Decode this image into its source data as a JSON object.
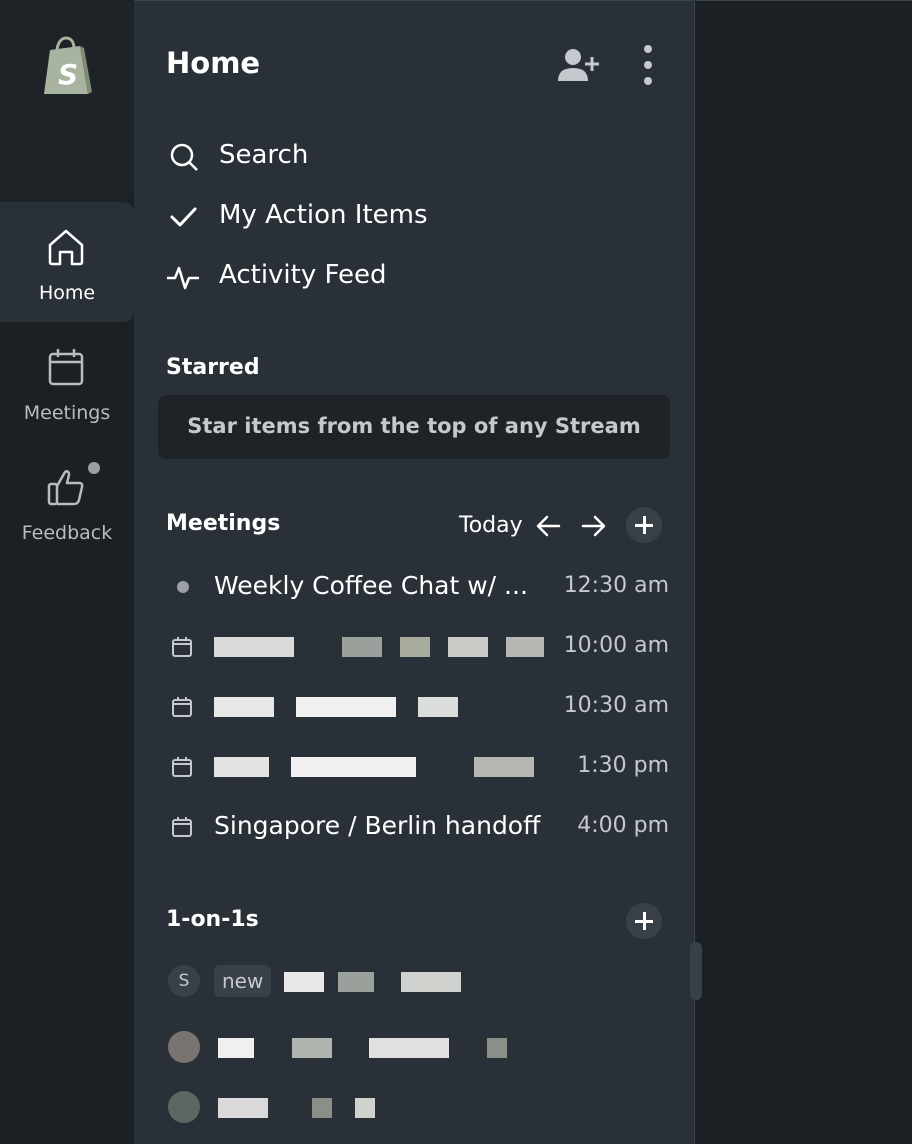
{
  "rail": {
    "items": [
      {
        "label": "Home",
        "icon": "home-icon",
        "active": true
      },
      {
        "label": "Meetings",
        "icon": "calendar-icon",
        "active": false
      },
      {
        "label": "Feedback",
        "icon": "thumbs-up-icon",
        "active": false
      }
    ]
  },
  "header": {
    "title": "Home",
    "add_user_icon": "add-user-icon",
    "more_icon": "more-vertical-icon"
  },
  "nav": [
    {
      "label": "Search",
      "icon": "search-icon"
    },
    {
      "label": "My Action Items",
      "icon": "check-icon"
    },
    {
      "label": "Activity Feed",
      "icon": "activity-icon"
    }
  ],
  "starred": {
    "title": "Starred",
    "empty_text": "Star items from the top of any Stream"
  },
  "meetings": {
    "title": "Meetings",
    "today_label": "Today",
    "items": [
      {
        "title": "Weekly Coffee Chat w/ ...",
        "time": "12:30 am",
        "icon": "dot"
      },
      {
        "title": "",
        "time": "10:00 am",
        "icon": "calendar-icon"
      },
      {
        "title": "",
        "time": "10:30 am",
        "icon": "calendar-icon"
      },
      {
        "title": "",
        "time": "1:30 pm",
        "icon": "calendar-icon"
      },
      {
        "title": "Singapore / Berlin handoff",
        "time": "4:00 pm",
        "icon": "calendar-icon"
      }
    ]
  },
  "one_on_ones": {
    "title": "1-on-1s",
    "items": [
      {
        "avatar_letter": "S",
        "tag": "new"
      },
      {
        "avatar_letter": ""
      },
      {
        "avatar_letter": ""
      }
    ]
  },
  "colors": {
    "rail_bg": "#1b2024",
    "panel_bg": "#2a3038",
    "logo_green": "#95bf47"
  }
}
